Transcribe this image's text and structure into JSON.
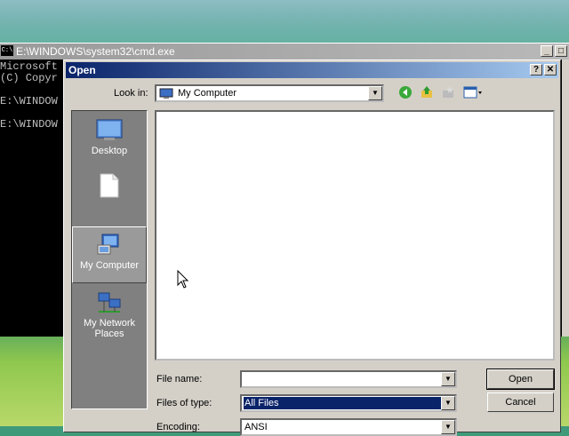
{
  "cmd": {
    "icon_text": "C:\\",
    "title": "E:\\WINDOWS\\system32\\cmd.exe",
    "lines": [
      "Microsoft",
      "(C) Copyr",
      "",
      "E:\\WINDOW",
      "",
      "E:\\WINDOW"
    ]
  },
  "dialog": {
    "title": "Open",
    "help_glyph": "?",
    "close_glyph": "✕",
    "look_in_label": "Look in:",
    "look_in_value": "My Computer",
    "places": [
      {
        "label": "Desktop"
      },
      {
        "label": ""
      },
      {
        "label": "My Computer"
      },
      {
        "label": "My Network Places"
      }
    ],
    "file_name_label": "File name:",
    "file_name_value": "",
    "files_of_type_label": "Files of type:",
    "files_of_type_value": "All Files",
    "encoding_label": "Encoding:",
    "encoding_value": "ANSI",
    "open_button": "Open",
    "cancel_button": "Cancel"
  },
  "icons": {
    "back": "back-arrow-icon",
    "up": "up-folder-icon",
    "new_folder": "new-folder-icon",
    "view_menu": "view-menu-icon"
  }
}
